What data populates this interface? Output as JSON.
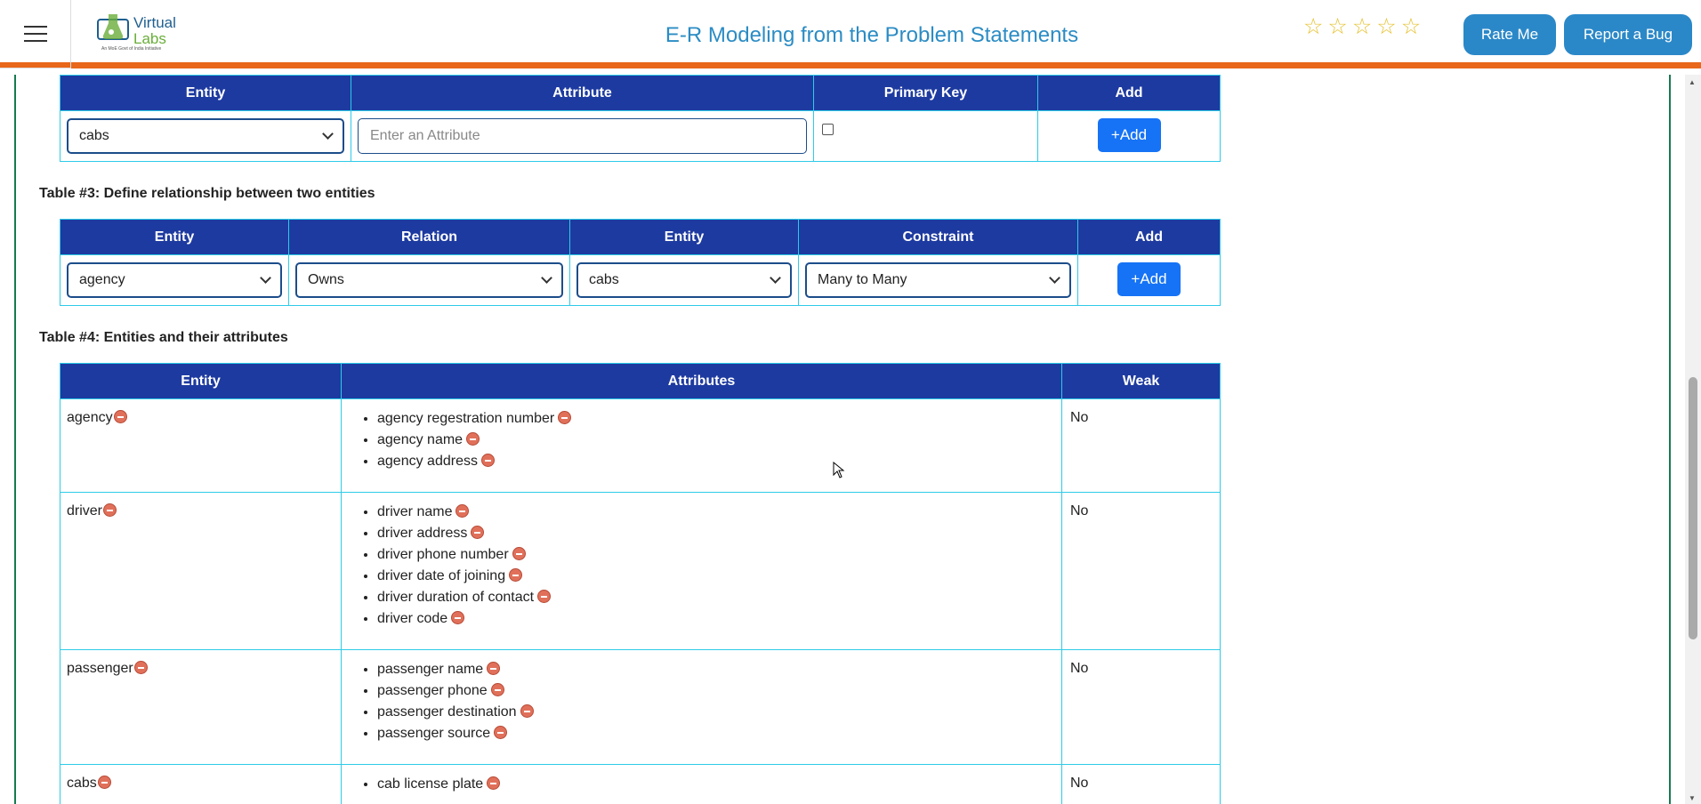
{
  "header": {
    "menu_icon": "hamburger-menu-icon",
    "logo": {
      "line1": "Virtual",
      "line2": "Labs",
      "tagline": "An MoE Govt of India Initiative"
    },
    "title": "E-R Modeling from the Problem Statements",
    "rating_stars": 5,
    "rate_label": "Rate Me",
    "bug_label": "Report a Bug",
    "accent_color": "#e8671a"
  },
  "table2": {
    "headers": [
      "Entity",
      "Attribute",
      "Primary Key",
      "Add"
    ],
    "entity_value": "cabs",
    "attribute_placeholder": "Enter an Attribute",
    "primary_key_checked": false,
    "add_label": "+Add"
  },
  "table3": {
    "label": "Table #3: Define relationship between two entities",
    "headers": [
      "Entity",
      "Relation",
      "Entity",
      "Constraint",
      "Add"
    ],
    "entity1": "agency",
    "relation": "Owns",
    "entity2": "cabs",
    "constraint": "Many to Many",
    "add_label": "+Add"
  },
  "table4": {
    "label": "Table #4: Entities and their attributes",
    "headers": [
      "Entity",
      "Attributes",
      "Weak"
    ],
    "rows": [
      {
        "entity": "agency",
        "weak": "No",
        "attributes": [
          "agency regestration number",
          "agency name",
          "agency address"
        ]
      },
      {
        "entity": "driver",
        "weak": "No",
        "attributes": [
          "driver name",
          "driver address",
          "driver phone number",
          "driver date of joining",
          "driver duration of contact",
          "driver code"
        ]
      },
      {
        "entity": "passenger",
        "weak": "No",
        "attributes": [
          "passenger name",
          "passenger phone",
          "passenger destination",
          "passenger source"
        ]
      },
      {
        "entity": "cabs",
        "weak": "No",
        "attributes": [
          "cab license plate"
        ]
      }
    ]
  }
}
